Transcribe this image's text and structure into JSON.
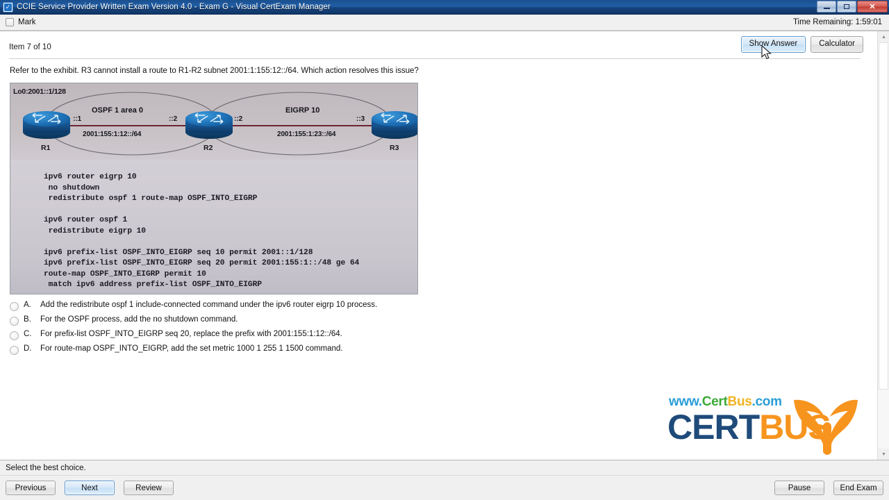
{
  "window": {
    "title": "CCIE Service Provider Written Exam Version 4.0 - Exam G - Visual CertExam Manager",
    "icon": "checkbox-icon",
    "minimize_label": "Minimize",
    "maximize_label": "Maximize",
    "close_label": "✕"
  },
  "markbar": {
    "mark_label": "Mark",
    "timer_label": "Time Remaining: 1:59:01"
  },
  "header": {
    "item_counter": "Item 7 of 10",
    "show_answer_label": "Show Answer",
    "calculator_label": "Calculator"
  },
  "question": {
    "text": "Refer to the exhibit. R3 cannot install a route to R1-R2 subnet 2001:1:155:12::/64. Which action resolves this issue?"
  },
  "exhibit": {
    "loopback_label": "Lo0:2001::1/128",
    "left_protocol": "OSPF 1 area 0",
    "right_protocol": "EIGRP 10",
    "routers": [
      {
        "name": "R1",
        "iface": "::1"
      },
      {
        "name": "R2",
        "iface_left": "::2",
        "iface_right": "::2"
      },
      {
        "name": "R3",
        "iface": "::3"
      }
    ],
    "left_subnet": "2001:155:1:12::/64",
    "right_subnet": "2001:155:1:23::/64",
    "config_lines": [
      "ipv6 router eigrp 10",
      " no shutdown",
      " redistribute ospf 1 route-map OSPF_INTO_EIGRP",
      "",
      "ipv6 router ospf 1",
      " redistribute eigrp 10",
      "",
      "ipv6 prefix-list OSPF_INTO_EIGRP seq 10 permit 2001::1/128",
      "ipv6 prefix-list OSPF_INTO_EIGRP seq 20 permit 2001:155:1::/48 ge 64",
      "route-map OSPF_INTO_EIGRP permit 10",
      " match ipv6 address prefix-list OSPF_INTO_EIGRP"
    ]
  },
  "options": [
    {
      "letter": "A.",
      "text": "Add the redistribute ospf 1 include-connected command under the ipv6 router eigrp 10 process.",
      "selected": false
    },
    {
      "letter": "B.",
      "text": "For the OSPF process, add the no shutdown command.",
      "selected": false
    },
    {
      "letter": "C.",
      "text": "For prefix-list OSPF_INTO_EIGRP seq 20, replace the prefix with 2001:155:1:12::/64.",
      "selected": false
    },
    {
      "letter": "D.",
      "text": "For route-map OSPF_INTO_EIGRP, add the set metric 1000 1 255 1 1500 command.",
      "selected": false
    }
  ],
  "logo": {
    "url_part1": "www.",
    "url_part2": "Cert",
    "url_part3": "Bus",
    "url_part4": ".com",
    "word1": "CERT",
    "word2": "BUS",
    "color_blue": "#2a9ed6",
    "color_green": "#3aa935",
    "color_yellow": "#f0b323",
    "color_navy": "#1f4b7a",
    "color_orange": "#f7941e"
  },
  "status": {
    "text": "Select the best choice."
  },
  "footer": {
    "previous_label": "Previous",
    "next_label": "Next",
    "review_label": "Review",
    "pause_label": "Pause",
    "end_exam_label": "End Exam"
  }
}
